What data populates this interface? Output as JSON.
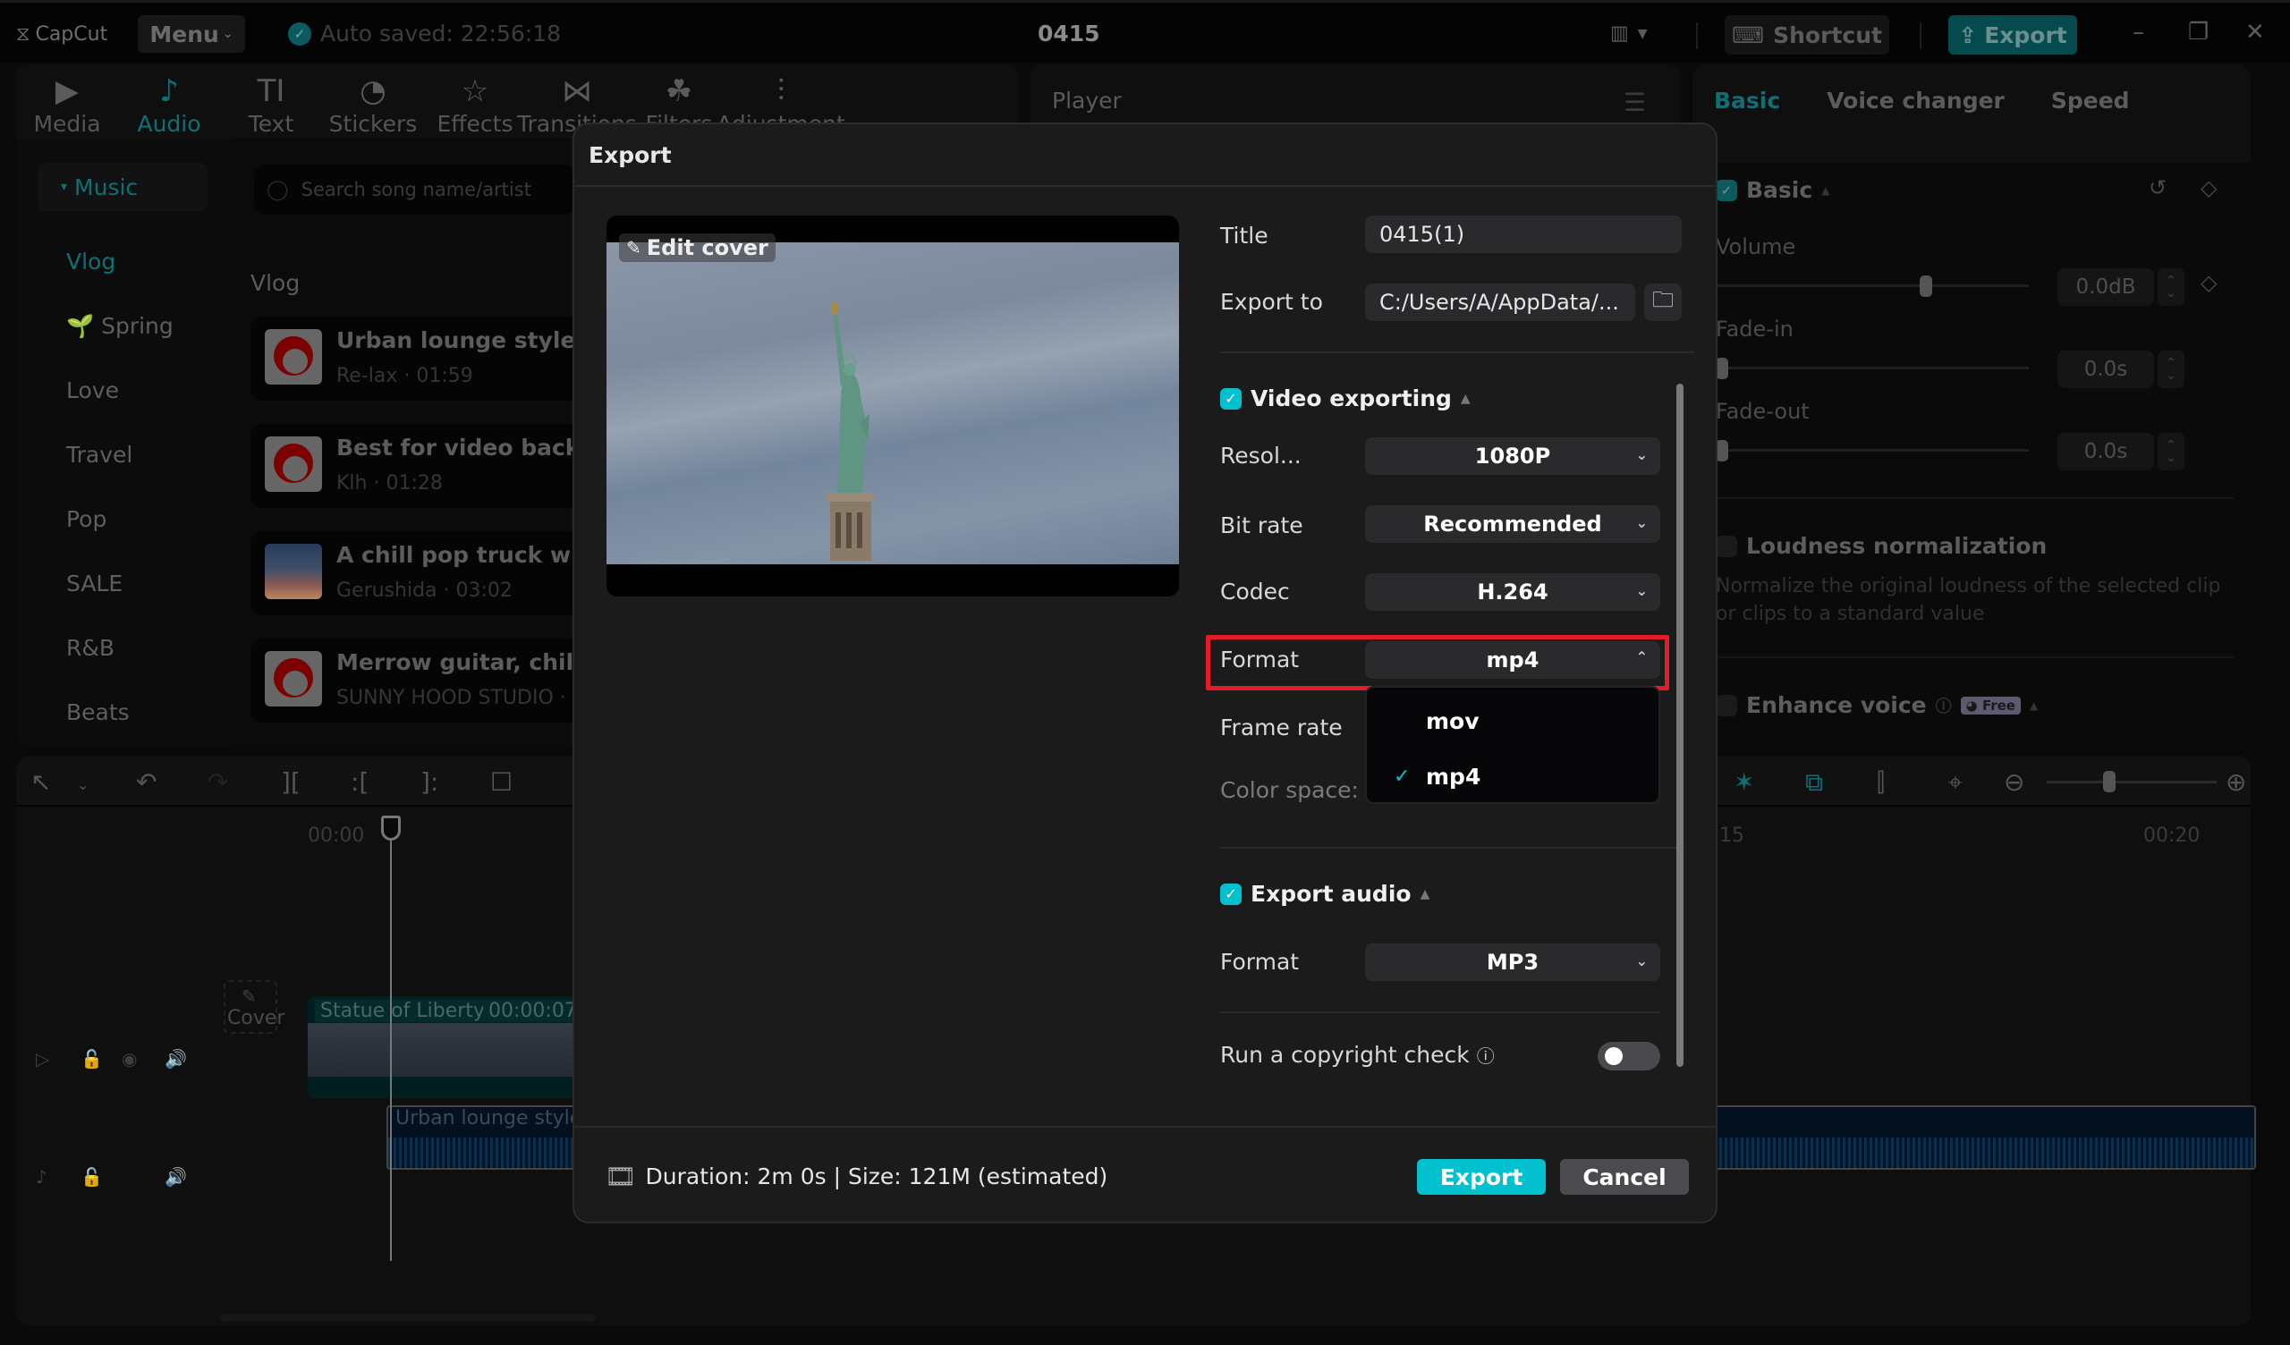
{
  "app": {
    "logo": "CapCut",
    "menu_label": "Menu",
    "autosave": "Auto saved: 22:56:18",
    "project_title": "0415",
    "shortcut_label": "Shortcut",
    "export_label": "Export",
    "window_controls": {
      "minimize": "–",
      "restore": "❐",
      "close": "✕"
    }
  },
  "tool_tabs": [
    {
      "label": "Media",
      "icon": "media-icon",
      "glyph": "▶",
      "active": false
    },
    {
      "label": "Audio",
      "icon": "audio-icon",
      "glyph": "♪",
      "active": true
    },
    {
      "label": "Text",
      "icon": "text-icon",
      "glyph": "TI",
      "active": false
    },
    {
      "label": "Stickers",
      "icon": "sticker-icon",
      "glyph": "◔",
      "active": false
    },
    {
      "label": "Effects",
      "icon": "effects-icon",
      "glyph": "☆",
      "active": false
    },
    {
      "label": "Transitions",
      "icon": "transitions-icon",
      "glyph": "⋈",
      "active": false
    },
    {
      "label": "Filters",
      "icon": "filters-icon",
      "glyph": "☘",
      "active": false
    },
    {
      "label": "Adjustment",
      "icon": "adjustment-icon",
      "glyph": "⫶",
      "active": false
    }
  ],
  "audio_sidebar": {
    "section": "Music",
    "categories": [
      "Vlog",
      "Spring",
      "Love",
      "Travel",
      "Pop",
      "SALE",
      "R&B",
      "Beats"
    ],
    "active_category": "Vlog"
  },
  "music_list": {
    "search_placeholder": "Search song name/artist",
    "heading": "Vlog",
    "songs": [
      {
        "title": "Urban lounge style BG",
        "subtitle": "Re-lax · 01:59"
      },
      {
        "title": "Best for video backgro",
        "subtitle": "Klh · 01:28"
      },
      {
        "title": "A chill pop truck with",
        "subtitle": "Gerushida · 03:02"
      },
      {
        "title": "Merrow guitar, chill ou",
        "subtitle": "SUNNY HOOD STUDIO ·"
      }
    ]
  },
  "player": {
    "title": "Player"
  },
  "inspector": {
    "tabs": [
      "Basic",
      "Voice changer",
      "Speed"
    ],
    "active_tab": "Basic",
    "basic_section": "Basic",
    "volume_label": "Volume",
    "volume_value": "0.0dB",
    "volume_level": 0.67,
    "fade_in_label": "Fade-in",
    "fade_in_value": "0.0s",
    "fade_out_label": "Fade-out",
    "fade_out_value": "0.0s",
    "loudness_label": "Loudness normalization",
    "loudness_desc": "Normalize the original loudness of the selected clip or clips to a standard value",
    "enhance_label": "Enhance voice",
    "free_badge": "Free"
  },
  "timeline": {
    "ruler": [
      "00:00",
      "15",
      "00:20"
    ],
    "video_clip_name": "Statue of Liberty",
    "video_clip_time": "00:00:07:",
    "audio_clip_name": "Urban lounge style",
    "cover_label": "Cover",
    "zoom_level": 0.37
  },
  "export_dialog": {
    "title": "Export",
    "edit_cover": "Edit cover",
    "title_label": "Title",
    "title_value": "0415(1)",
    "export_to_label": "Export to",
    "export_to_value": "C:/Users/A/AppData/...",
    "video_section": "Video exporting",
    "video_enabled": true,
    "resolution_label": "Resol...",
    "resolution_value": "1080P",
    "bitrate_label": "Bit rate",
    "bitrate_value": "Recommended",
    "codec_label": "Codec",
    "codec_value": "H.264",
    "format_label": "Format",
    "format_value": "mp4",
    "format_options": [
      {
        "label": "mov",
        "selected": false
      },
      {
        "label": "mp4",
        "selected": true
      }
    ],
    "frame_rate_label": "Frame rate",
    "color_space_label": "Color space: S",
    "audio_section": "Export audio",
    "audio_enabled": true,
    "audio_format_label": "Format",
    "audio_format_value": "MP3",
    "copyright_label": "Run a copyright check",
    "copyright_enabled": false,
    "footer_info": "Duration: 2m 0s | Size: 121M (estimated)",
    "export_button": "Export",
    "cancel_button": "Cancel"
  },
  "colors": {
    "accent": "#00c1cd",
    "highlight": "#e41c2a",
    "dialog_bg": "#1b1b1b"
  }
}
